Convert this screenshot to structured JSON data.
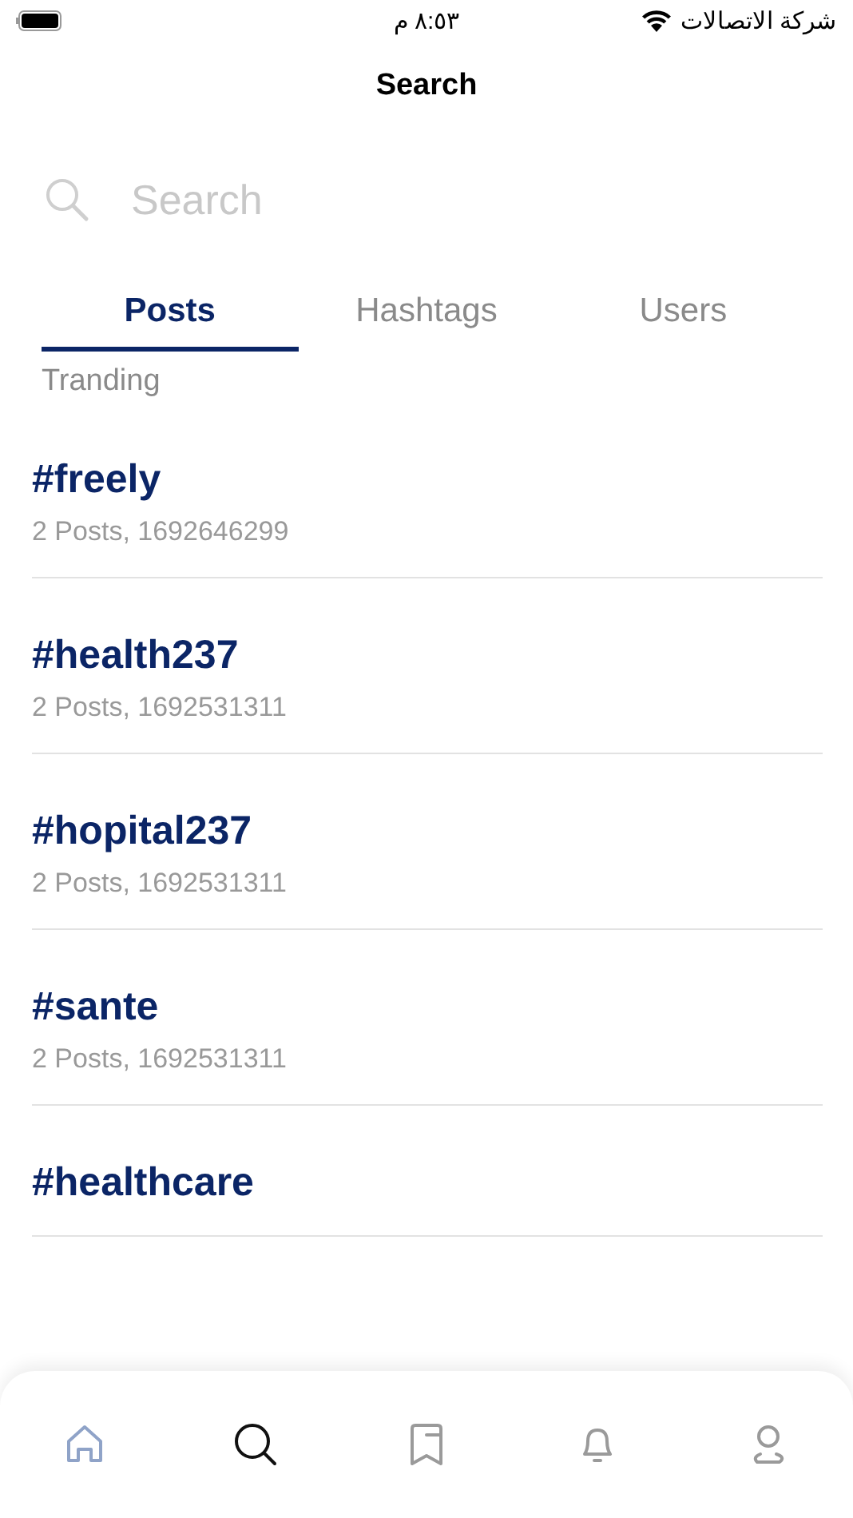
{
  "status_bar": {
    "carrier": "شركة الاتصالات",
    "time": "٨:٥٣ م"
  },
  "title": "Search",
  "search": {
    "placeholder": "Search"
  },
  "tabs": [
    {
      "label": "Posts",
      "selected": true
    },
    {
      "label": "Hashtags",
      "selected": false
    },
    {
      "label": "Users",
      "selected": false
    }
  ],
  "section_label": "Tranding",
  "results": [
    {
      "tag": "#freely",
      "meta": "2 Posts, 1692646299"
    },
    {
      "tag": "#health237",
      "meta": "2 Posts, 1692531311"
    },
    {
      "tag": "#hopital237",
      "meta": "2 Posts, 1692531311"
    },
    {
      "tag": "#sante",
      "meta": "2 Posts, 1692531311"
    },
    {
      "tag": "#healthcare"
    }
  ],
  "nav": [
    {
      "kind": "home",
      "selected": false
    },
    {
      "kind": "search",
      "selected": true
    },
    {
      "kind": "bookmark",
      "selected": false
    },
    {
      "kind": "bell",
      "selected": false
    },
    {
      "kind": "profile",
      "selected": false
    }
  ]
}
